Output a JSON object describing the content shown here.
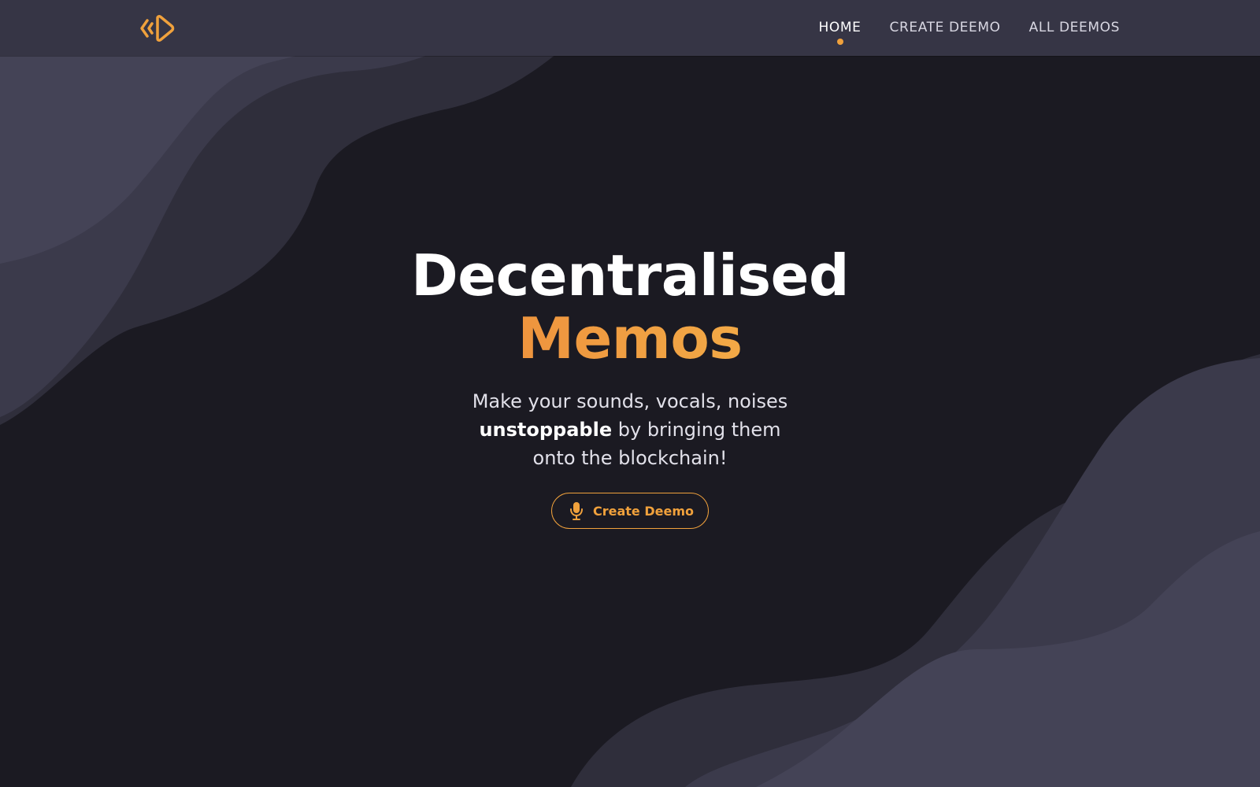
{
  "colors": {
    "background": "#1b1a22",
    "navbar": "#363545",
    "accent": "#f0a13c",
    "wave_light": "#444356",
    "wave_mid": "#3b3a4b",
    "wave_dark": "#2f2e3b"
  },
  "brand": {
    "logo_icon": "deemo-logo-icon"
  },
  "nav": {
    "items": [
      {
        "label": "HOME",
        "active": true
      },
      {
        "label": "CREATE DEEMO",
        "active": false
      },
      {
        "label": "ALL DEEMOS",
        "active": false
      }
    ]
  },
  "hero": {
    "title_line1": "Decentralised",
    "title_line2": "Memos",
    "tagline_part1": "Make your sounds, vocals, noises",
    "tagline_strong": "unstoppable",
    "tagline_part2": "by bringing them onto the blockchain!",
    "cta_label": "Create Deemo",
    "cta_icon": "microphone-icon"
  }
}
